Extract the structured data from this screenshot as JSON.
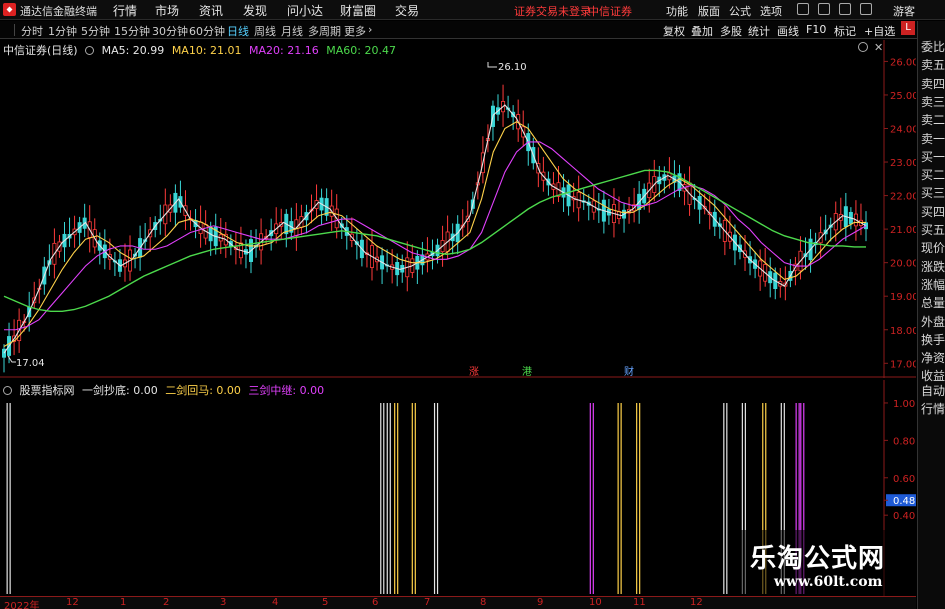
{
  "app": {
    "title": "通达信金融终端"
  },
  "menu": [
    "行情",
    "市场",
    "资讯",
    "发现",
    "问小达",
    "财富圈",
    "交易"
  ],
  "notice": {
    "text": "证券交易未登录",
    "broker": "中信证券"
  },
  "top_right": [
    "功能",
    "版面",
    "公式",
    "选项",
    "游客"
  ],
  "periods": [
    {
      "label": "分时",
      "active": false
    },
    {
      "label": "1分钟",
      "active": false
    },
    {
      "label": "5分钟",
      "active": false
    },
    {
      "label": "15分钟",
      "active": false
    },
    {
      "label": "30分钟",
      "active": false
    },
    {
      "label": "60分钟",
      "active": false
    },
    {
      "label": "日线",
      "active": true
    },
    {
      "label": "周线",
      "active": false
    },
    {
      "label": "月线",
      "active": false
    },
    {
      "label": "多周期",
      "active": false
    },
    {
      "label": "更多",
      "active": false
    }
  ],
  "toolbar_right": [
    "复权",
    "叠加",
    "多股",
    "统计",
    "画线",
    "F10",
    "标记",
    "+自选"
  ],
  "side_tabs": [
    "委比",
    "卖五",
    "卖四",
    "卖三",
    "卖二",
    "卖一",
    "买一",
    "买二",
    "买三",
    "买四",
    "买五",
    "现价",
    "涨跌",
    "涨幅",
    "总量",
    "外盘",
    "换手",
    "净资",
    "收益",
    "自动",
    "行情"
  ],
  "side_badge": "L",
  "main_legend": {
    "title": "中信证券(日线)",
    "ma": [
      {
        "label": "MA5: 20.99",
        "color": "#e6e6e6"
      },
      {
        "label": "MA10: 21.01",
        "color": "#ffd24a"
      },
      {
        "label": "MA20: 21.16",
        "color": "#e040fb"
      },
      {
        "label": "MA60: 20.47",
        "color": "#4cd94c"
      }
    ]
  },
  "sub_legend": {
    "title": "股票指标网",
    "items": [
      {
        "label": "一剑抄底: 0.00",
        "color": "#e6e6e6"
      },
      {
        "label": "二剑回马: 0.00",
        "color": "#ffd24a"
      },
      {
        "label": "三剑中继: 0.00",
        "color": "#e040fb"
      }
    ]
  },
  "price_axis": [
    "26.00",
    "25.00",
    "24.00",
    "23.00",
    "22.00",
    "21.00",
    "20.00",
    "19.00",
    "18.00",
    "17.00"
  ],
  "sub_axis": [
    "1.00",
    "0.80",
    "0.60",
    "0.48",
    "0.40"
  ],
  "annotations": {
    "high": "26.10",
    "low": "17.04"
  },
  "event_markers": [
    {
      "text": "涨",
      "color": "#ff3b3b"
    },
    {
      "text": "港",
      "color": "#4cd94c"
    },
    {
      "text": "财",
      "color": "#66a3ff"
    }
  ],
  "x_axis": [
    "2022年",
    "12",
    "1",
    "2",
    "3",
    "4",
    "5",
    "6",
    "7",
    "8",
    "9",
    "10",
    "11",
    "12"
  ],
  "watermark": {
    "cn": "乐淘公式网",
    "url": "www.60lt.com"
  },
  "chart_data": {
    "type": "candlestick",
    "ylim": [
      16.8,
      26.4
    ],
    "ma_lines": [
      {
        "name": "MA5",
        "values": [
          17.3,
          17.8,
          18.4,
          19.2,
          20.1,
          20.6,
          20.9,
          21.2,
          20.6,
          20.2,
          19.9,
          20.1,
          20.6,
          21.1,
          21.5,
          21.9,
          21.3,
          21.0,
          20.8,
          20.7,
          20.4,
          20.3,
          20.6,
          20.9,
          21.2,
          21.0,
          21.4,
          21.8,
          21.6,
          21.1,
          20.7,
          20.3,
          20.1,
          19.9,
          19.8,
          19.9,
          20.1,
          20.3,
          20.6,
          20.9,
          21.4,
          22.8,
          24.4,
          24.7,
          24.3,
          23.6,
          22.7,
          22.3,
          22.1,
          21.9,
          21.8,
          21.6,
          21.5,
          21.4,
          21.6,
          22.0,
          22.4,
          22.6,
          22.4,
          22.0,
          21.7,
          21.3,
          20.9,
          20.5,
          20.1,
          19.8,
          19.5,
          19.3,
          19.9,
          20.3,
          20.7,
          21.1,
          21.4,
          21.3,
          21.1
        ]
      },
      {
        "name": "MA10",
        "values": [
          17.5,
          17.7,
          18.1,
          18.6,
          19.2,
          19.8,
          20.3,
          20.7,
          20.8,
          20.6,
          20.3,
          20.1,
          20.2,
          20.5,
          20.8,
          21.2,
          21.3,
          21.2,
          21.0,
          20.8,
          20.6,
          20.5,
          20.5,
          20.6,
          20.9,
          21.0,
          21.1,
          21.4,
          21.5,
          21.4,
          21.1,
          20.8,
          20.5,
          20.3,
          20.1,
          20.0,
          20.0,
          20.1,
          20.3,
          20.6,
          20.9,
          21.9,
          23.3,
          24.0,
          24.2,
          24.0,
          23.5,
          23.0,
          22.5,
          22.2,
          22.0,
          21.8,
          21.6,
          21.5,
          21.5,
          21.7,
          22.0,
          22.3,
          22.5,
          22.3,
          22.0,
          21.7,
          21.3,
          20.9,
          20.5,
          20.1,
          19.8,
          19.5,
          19.6,
          19.9,
          20.3,
          20.7,
          21.0,
          21.2,
          21.2
        ]
      },
      {
        "name": "MA20",
        "values": [
          18.0,
          18.0,
          18.1,
          18.3,
          18.7,
          19.1,
          19.5,
          19.9,
          20.2,
          20.4,
          20.5,
          20.5,
          20.4,
          20.4,
          20.5,
          20.7,
          20.9,
          21.0,
          21.1,
          21.0,
          20.9,
          20.8,
          20.7,
          20.7,
          20.7,
          20.8,
          20.9,
          21.1,
          21.2,
          21.3,
          21.3,
          21.1,
          20.9,
          20.7,
          20.5,
          20.3,
          20.2,
          20.1,
          20.1,
          20.2,
          20.4,
          20.9,
          21.8,
          22.7,
          23.3,
          23.6,
          23.6,
          23.4,
          23.1,
          22.8,
          22.5,
          22.2,
          22.0,
          21.8,
          21.7,
          21.7,
          21.8,
          22.0,
          22.2,
          22.3,
          22.2,
          22.0,
          21.7,
          21.3,
          21.0,
          20.6,
          20.3,
          20.0,
          19.9,
          19.9,
          20.1,
          20.4,
          20.7,
          20.9,
          21.1
        ]
      },
      {
        "name": "MA60",
        "values": [
          19.0,
          18.85,
          18.7,
          18.6,
          18.55,
          18.55,
          18.6,
          18.7,
          18.85,
          19.0,
          19.2,
          19.4,
          19.6,
          19.75,
          19.9,
          20.05,
          20.2,
          20.3,
          20.4,
          20.45,
          20.5,
          20.55,
          20.6,
          20.65,
          20.7,
          20.75,
          20.8,
          20.85,
          20.9,
          20.95,
          20.9,
          20.85,
          20.8,
          20.7,
          20.6,
          20.5,
          20.4,
          20.3,
          20.25,
          20.3,
          20.4,
          20.6,
          20.85,
          21.1,
          21.35,
          21.6,
          21.8,
          21.95,
          22.05,
          22.15,
          22.25,
          22.35,
          22.45,
          22.55,
          22.65,
          22.75,
          22.75,
          22.7,
          22.55,
          22.35,
          22.15,
          21.95,
          21.75,
          21.55,
          21.35,
          21.15,
          20.95,
          20.8,
          20.7,
          20.6,
          20.55,
          20.5,
          20.5,
          20.47,
          20.47
        ]
      }
    ],
    "signals": {
      "series": [
        "一剑抄底",
        "二剑回马",
        "三剑中继"
      ],
      "events": [
        {
          "x": 0.5,
          "series": 0
        },
        {
          "x": 40.8,
          "series": 0
        },
        {
          "x": 41.5,
          "series": 0
        },
        {
          "x": 42.3,
          "series": 1
        },
        {
          "x": 44.2,
          "series": 1
        },
        {
          "x": 46.6,
          "series": 0
        },
        {
          "x": 63.4,
          "series": 2
        },
        {
          "x": 66.4,
          "series": 1
        },
        {
          "x": 68.4,
          "series": 1
        },
        {
          "x": 77.8,
          "series": 0
        },
        {
          "x": 79.8,
          "series": 0
        },
        {
          "x": 82.0,
          "series": 1
        },
        {
          "x": 84.0,
          "series": 0
        },
        {
          "x": 85.6,
          "series": 2
        },
        {
          "x": 86.1,
          "series": 2
        }
      ]
    }
  }
}
